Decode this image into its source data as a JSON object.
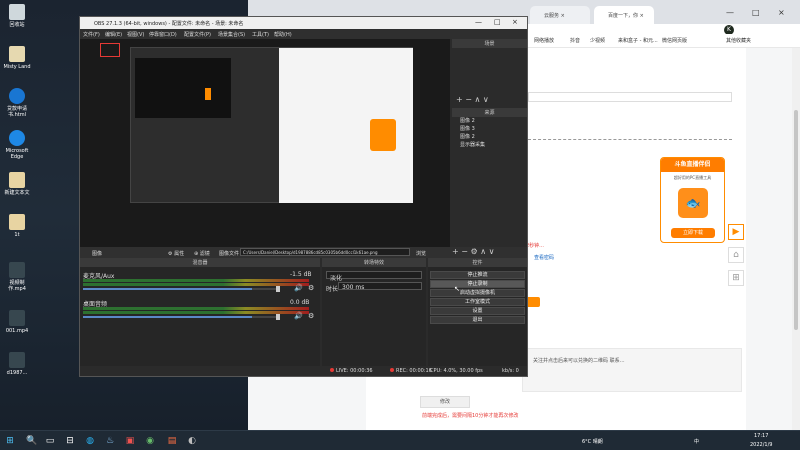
{
  "desktop": {
    "icons": [
      {
        "label": "回收站",
        "color": "#cfd8dc"
      },
      {
        "label": "Misty Land",
        "color": "#e6d9b0"
      },
      {
        "label": "贷款申请书.html",
        "color": "#1976d2"
      },
      {
        "label": "Microsoft Edge",
        "color": "#1e88e5"
      },
      {
        "label": "新建文本文",
        "color": "#e8d4a2"
      },
      {
        "label": "1t",
        "color": "#e8d4a2"
      },
      {
        "label": "视频制作.mp4",
        "color": "#37474f"
      },
      {
        "label": "001.mp4",
        "color": "#37474f"
      },
      {
        "label": "d1987...",
        "color": "#37474f"
      }
    ]
  },
  "browser": {
    "tabs": [
      {
        "label": "云服务 ×"
      },
      {
        "label": "百度一下，你 ×"
      }
    ],
    "window_controls": {
      "minimize": "—",
      "maximize": "□",
      "close": "×"
    },
    "user_avatar": "K",
    "bookmarks": [
      "网络播放",
      "抖音",
      "少视频",
      "来和盒子 - 和元...",
      "微信网页版",
      "其他收藏夹"
    ],
    "page": {
      "red_text_1": "2秒钟...",
      "red_text_2": "前端完成后，需要间隔10分钟才能再次修改",
      "gray_button": "修改",
      "link_1": "查看密码",
      "box_text": "关注并点击后来可以兑换的二维码 联系…"
    }
  },
  "obs": {
    "title": "OBS 27.1.3 (64-bit, windows) - 配置文件: 未命名 - 场景: 未命名",
    "menu": [
      "文件(F)",
      "编辑(E)",
      "视图(V)",
      "停靠窗口(D)",
      "配置文件(P)",
      "场景集合(S)",
      "工具(T)",
      "帮助(H)"
    ],
    "scenes_title": "场景",
    "sources_title": "来源",
    "sources": [
      {
        "name": "图像 2"
      },
      {
        "name": "图像 3"
      },
      {
        "name": "图像 2"
      },
      {
        "name": "显示器采集"
      }
    ],
    "toolbar": {
      "source_label": "图像",
      "props": "⚙ 属性",
      "filters": "⊕ 滤镜",
      "image_file_label": "图像文件",
      "path": "C:/Users/Daniel/Desktop/d1987886cd85c0305b6dd0ccl1k61ae.png",
      "browse": "浏览"
    },
    "mixer": {
      "title": "混音器",
      "tracks": [
        {
          "name": "麦克风/Aux",
          "db": "-1.5 dB",
          "level": 0.86
        },
        {
          "name": "桌面音频",
          "db": "0.0 dB",
          "level": 0.86
        }
      ]
    },
    "transition": {
      "title": "转场特效",
      "type": "淡化",
      "duration_label": "时长",
      "duration_value": "300 ms"
    },
    "controls": {
      "title": "控件",
      "buttons": [
        {
          "label": "停止推流"
        },
        {
          "label": "停止录制"
        },
        {
          "label": "启动虚拟摄像机"
        },
        {
          "label": "工作室模式"
        },
        {
          "label": "设置"
        },
        {
          "label": "退出"
        }
      ]
    },
    "status": {
      "live": "LIVE: 00:00:36",
      "rec": "REC: 00:00:16",
      "cpu": "CPU: 4.0%, 30.00 fps",
      "kbps": "kb/s: 0"
    }
  },
  "ad": {
    "title": "斗鱼直播伴侣",
    "subtitle": "超好用的PC直播工具",
    "logo_glyph": "🐟",
    "download_btn": "立即下载"
  },
  "sidebar_buttons": [
    "▶",
    "⌂",
    "⊞"
  ],
  "taskbar": {
    "weather": "6°C 晴朗",
    "ime": "中",
    "time": "17:17",
    "date": "2022/1/9",
    "icons": [
      "⊞",
      "🔍",
      "▭",
      "⊟",
      "◍",
      "♨",
      "▣",
      "◉",
      "▤",
      "◐"
    ]
  }
}
